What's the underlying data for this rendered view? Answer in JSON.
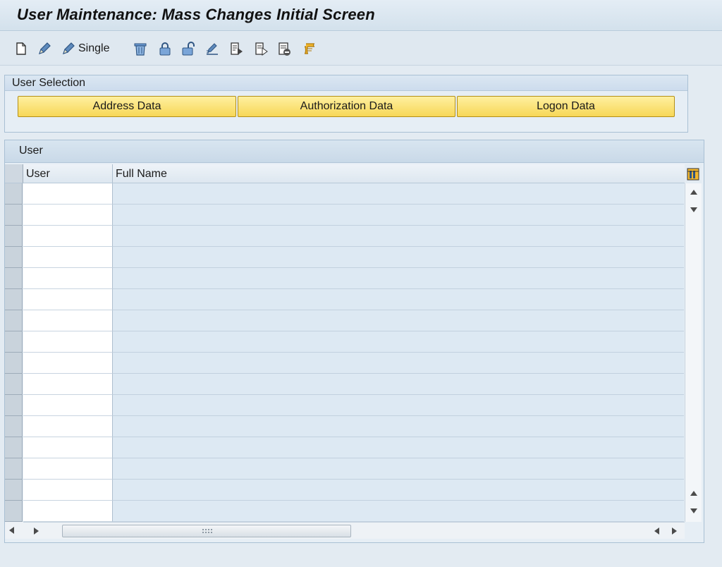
{
  "window": {
    "title": "User Maintenance: Mass Changes Initial Screen"
  },
  "toolbar": {
    "items": [
      {
        "name": "new-icon"
      },
      {
        "name": "change-pencil-icon"
      },
      {
        "name": "single-pencil-icon",
        "label": "Single"
      },
      {
        "name": "delete-icon"
      },
      {
        "name": "lock-icon"
      },
      {
        "name": "unlock-icon"
      },
      {
        "name": "pencil-doc-icon"
      },
      {
        "name": "document-arrow-icon"
      },
      {
        "name": "document-arrow-outline-icon"
      },
      {
        "name": "document-minus-icon"
      },
      {
        "name": "scroll-icon"
      }
    ],
    "single_label": "Single"
  },
  "user_selection": {
    "title": "User Selection",
    "buttons": [
      "Address Data",
      "Authorization Data",
      "Logon Data"
    ]
  },
  "user_table": {
    "title": "User",
    "columns": [
      "User",
      "Full Name"
    ],
    "row_count": 16,
    "rows": []
  },
  "colors": {
    "accent_yellow": "#f7d757",
    "header_blue": "#cddced",
    "cell_blue": "#dde9f3"
  }
}
